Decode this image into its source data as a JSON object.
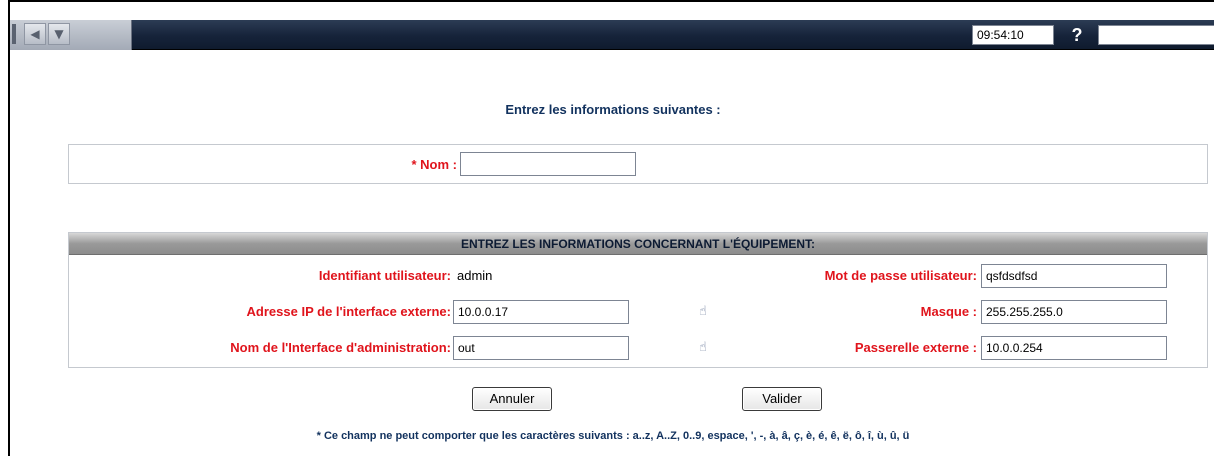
{
  "toolbar": {
    "nav_back_icon": "triangle-left-icon",
    "nav_down_icon": "triangle-down-icon",
    "clock": "09:54:10",
    "help_label": "?"
  },
  "intro": "Entrez les informations suivantes :",
  "name_field": {
    "label": "* Nom :",
    "value": ""
  },
  "equipment": {
    "header": "ENTREZ LES INFORMATIONS CONCERNANT L'ÉQUIPEMENT:",
    "user_id_label": "Identifiant utilisateur:",
    "user_id_value": "admin",
    "password_label": "Mot de passe utilisateur:",
    "password_value": "qsfdsdfsd",
    "ext_ip_label": "Adresse IP de l'interface externe:",
    "ext_ip_value": "10.0.0.17",
    "mask_label": "Masque :",
    "mask_value": "255.255.255.0",
    "admin_iface_label": "Nom de l'Interface d'administration:",
    "admin_iface_value": "out",
    "gateway_label": "Passerelle externe :",
    "gateway_value": "10.0.0.254",
    "hint_icon": "help-hand-icon"
  },
  "buttons": {
    "cancel": "Annuler",
    "submit": "Valider"
  },
  "footnote": "* Ce champ ne peut comporter que les caractères suivants : a..z, A..Z, 0..9, espace, ', -, à, â, ç, è, é, ê, ë, ô, î, ù, û, ü",
  "colors": {
    "required_label": "#e0141c",
    "heading_text": "#12325e",
    "toolbar_bg": "#16233a"
  }
}
